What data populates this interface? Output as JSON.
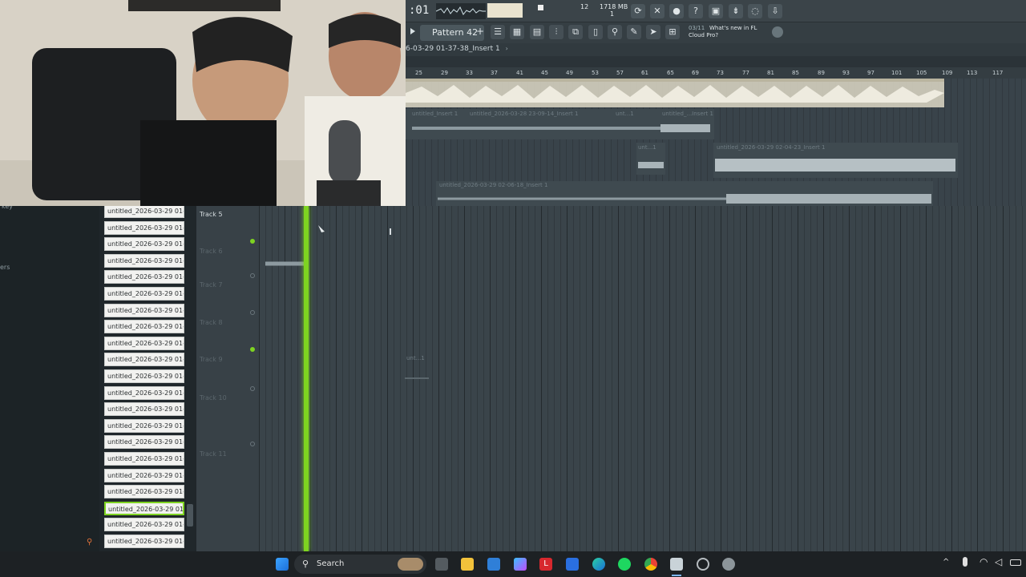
{
  "toolbar": {
    "time": ":01",
    "bpm_value": "12",
    "memory": "1718 MB",
    "memory_sub": "1",
    "news_counter": "03/11",
    "news_text": "What's new in FL Cloud Pro?",
    "pattern_label": "Pattern 42"
  },
  "pathbar": {
    "label": "6-03-29 01-37-38_Insert 1"
  },
  "ruler": {
    "ticks": [
      "25",
      "29",
      "33",
      "37",
      "41",
      "45",
      "49",
      "53",
      "57",
      "61",
      "65",
      "69",
      "73",
      "77",
      "81",
      "85",
      "89",
      "93",
      "97",
      "101",
      "105",
      "109",
      "113",
      "117"
    ]
  },
  "browser": {
    "left_labels": [
      "key",
      "ers"
    ],
    "items": [
      "untitled_2026-03-29 01-...",
      "untitled_2026-03-29 01-...",
      "untitled_2026-03-29 01-...",
      "untitled_2026-03-29 01-...",
      "untitled_2026-03-29 01-...",
      "untitled_2026-03-29 01-...",
      "untitled_2026-03-29 01-...",
      "untitled_2026-03-29 01-...",
      "untitled_2026-03-29 01-...",
      "untitled_2026-03-29 01-...",
      "untitled_2026-03-29 01-...",
      "untitled_2026-03-29 01-...",
      "untitled_2026-03-29 01-...",
      "untitled_2026-03-29 01-...",
      "untitled_2026-03-29 01-...",
      "untitled_2026-03-29 01-...",
      "untitled_2026-03-29 01-...",
      "untitled_2026-03-29 01-...",
      "untitled_2026-03-29 01-...",
      "untitled_2026-03-29 01-...",
      "untitled_2026-03-29 01-..."
    ],
    "selected_index": 18
  },
  "tracks": {
    "names": [
      "Track 5",
      "Track 6",
      "Track 7",
      "Track 8",
      "Track 9",
      "Track 10",
      "Track 11"
    ]
  },
  "clips": {
    "upper_row1": [
      "untitled_Insert 1",
      "untitled_2026-03-28 23-09-14_Insert 1",
      "unt...1",
      "untitled_...Insert 1"
    ],
    "upper_row2": [
      "unt...1",
      "untitled_2026-03-29 02-04-23_Insert 1"
    ],
    "upper_row3": [
      "untitled_2026-03-29 02-06-18_Insert 1"
    ],
    "lower_clip": "unt...1"
  },
  "taskbar": {
    "search_label": "Search"
  },
  "colors": {
    "accent_green": "#7ed321",
    "playlist_bg": "#3a444a",
    "toolbar_bg": "#3b4449",
    "taskbar_bg": "#1d2124"
  },
  "icons": [
    "windows-start-icon",
    "search-icon",
    "file-explorer-icon",
    "store-icon",
    "copilot-icon",
    "edge-icon",
    "spotify-icon",
    "chrome-icon",
    "fl-studio-icon",
    "settings-icon",
    "wifi-icon",
    "volume-icon",
    "battery-icon",
    "microphone-icon",
    "chevron-up-icon"
  ]
}
